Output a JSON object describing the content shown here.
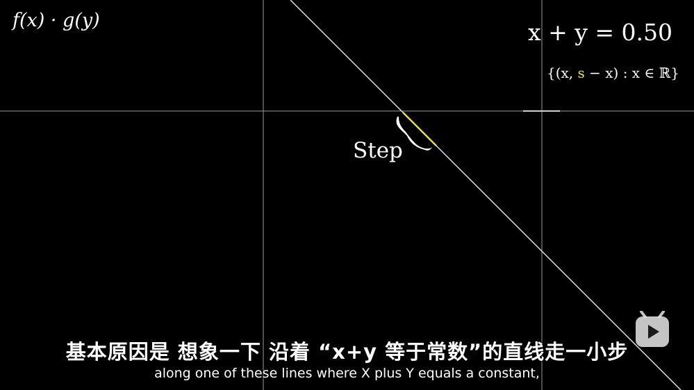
{
  "formulas": {
    "product": "f(x) · g(y)",
    "sum_lhs": "x + y = 0.50",
    "set_open": "{(x, ",
    "set_var": "s",
    "set_close": " − x) : x ∈ ℝ}"
  },
  "annotation": {
    "step_label": "Step"
  },
  "subtitles": {
    "zh": "基本原因是  想象一下  沿着 “x+y 等于常数”的直线走一小步",
    "en": "along one of these lines where X plus Y equals a constant,"
  },
  "colors": {
    "accent_yellow": "#e6e24a",
    "axis": "#9a9a9a",
    "line": "#e8e8e8"
  },
  "icons": {
    "player_badge": "play-icon"
  }
}
